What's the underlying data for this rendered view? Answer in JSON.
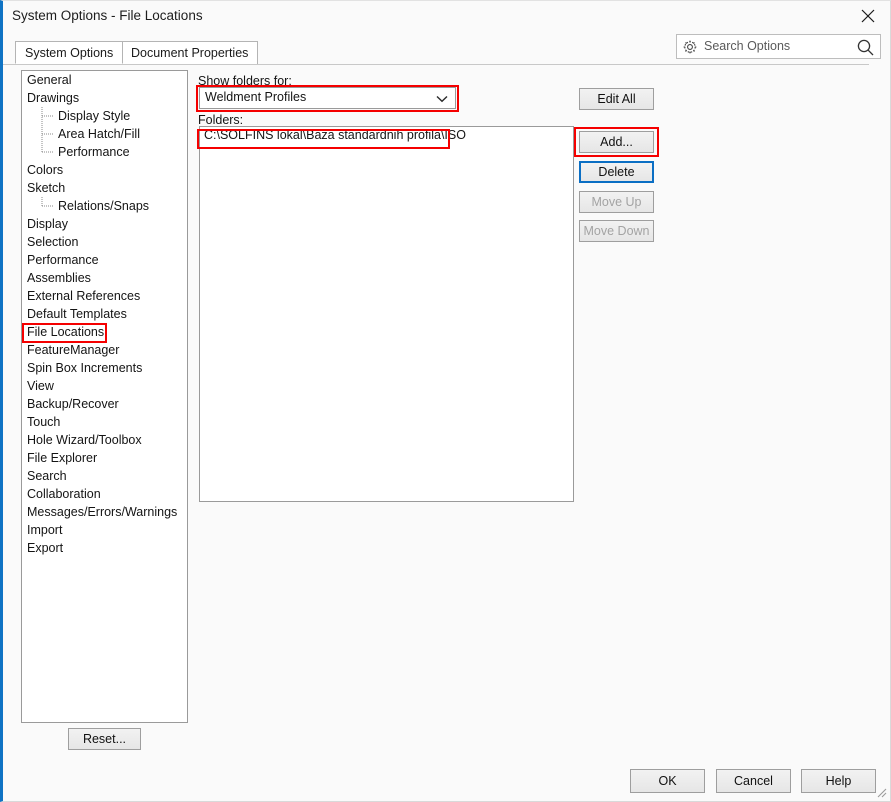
{
  "window": {
    "title": "System Options - File Locations",
    "accent_color": "#0f73c4",
    "highlight_color": "#f50000",
    "focus_color": "#0b6fc4",
    "close_icon": "close-icon",
    "resize_grip": "resize-grip-icon"
  },
  "tabs": [
    {
      "label": "System Options",
      "active": true
    },
    {
      "label": "Document Properties",
      "active": false
    }
  ],
  "search": {
    "placeholder": "Search Options",
    "gear_icon": "gear-icon",
    "magnifier_icon": "search-icon"
  },
  "sidebar": {
    "items": [
      {
        "label": "General",
        "level": 0,
        "selected": false
      },
      {
        "label": "Drawings",
        "level": 0,
        "selected": false
      },
      {
        "label": "Display Style",
        "level": 1,
        "selected": false
      },
      {
        "label": "Area Hatch/Fill",
        "level": 1,
        "selected": false
      },
      {
        "label": "Performance",
        "level": 1,
        "selected": false
      },
      {
        "label": "Colors",
        "level": 0,
        "selected": false
      },
      {
        "label": "Sketch",
        "level": 0,
        "selected": false
      },
      {
        "label": "Relations/Snaps",
        "level": 1,
        "selected": false
      },
      {
        "label": "Display",
        "level": 0,
        "selected": false
      },
      {
        "label": "Selection",
        "level": 0,
        "selected": false
      },
      {
        "label": "Performance",
        "level": 0,
        "selected": false
      },
      {
        "label": "Assemblies",
        "level": 0,
        "selected": false
      },
      {
        "label": "External References",
        "level": 0,
        "selected": false
      },
      {
        "label": "Default Templates",
        "level": 0,
        "selected": false
      },
      {
        "label": "File Locations",
        "level": 0,
        "selected": true
      },
      {
        "label": "FeatureManager",
        "level": 0,
        "selected": false
      },
      {
        "label": "Spin Box Increments",
        "level": 0,
        "selected": false
      },
      {
        "label": "View",
        "level": 0,
        "selected": false
      },
      {
        "label": "Backup/Recover",
        "level": 0,
        "selected": false
      },
      {
        "label": "Touch",
        "level": 0,
        "selected": false
      },
      {
        "label": "Hole Wizard/Toolbox",
        "level": 0,
        "selected": false
      },
      {
        "label": "File Explorer",
        "level": 0,
        "selected": false
      },
      {
        "label": "Search",
        "level": 0,
        "selected": false
      },
      {
        "label": "Collaboration",
        "level": 0,
        "selected": false
      },
      {
        "label": "Messages/Errors/Warnings",
        "level": 0,
        "selected": false
      },
      {
        "label": "Import",
        "level": 0,
        "selected": false
      },
      {
        "label": "Export",
        "level": 0,
        "selected": false
      }
    ],
    "reset_label": "Reset..."
  },
  "main": {
    "show_folders_label": "Show folders for:",
    "folders_label": "Folders:",
    "dropdown": {
      "value": "Weldment Profiles",
      "chevron_icon": "chevron-down-icon",
      "highlighted": true
    },
    "folders": [
      {
        "path": "C:\\SOLFINS lokal\\Baza standardnih profila\\ISO",
        "highlighted": true
      }
    ],
    "buttons": [
      {
        "label": "Edit All",
        "enabled": true,
        "focused": false,
        "highlighted": false
      },
      {
        "label": "Add...",
        "enabled": true,
        "focused": false,
        "highlighted": true
      },
      {
        "label": "Delete",
        "enabled": true,
        "focused": true,
        "highlighted": false
      },
      {
        "label": "Move Up",
        "enabled": false,
        "focused": false,
        "highlighted": false
      },
      {
        "label": "Move Down",
        "enabled": false,
        "focused": false,
        "highlighted": false
      }
    ]
  },
  "footer": {
    "ok_label": "OK",
    "cancel_label": "Cancel",
    "help_label": "Help"
  }
}
